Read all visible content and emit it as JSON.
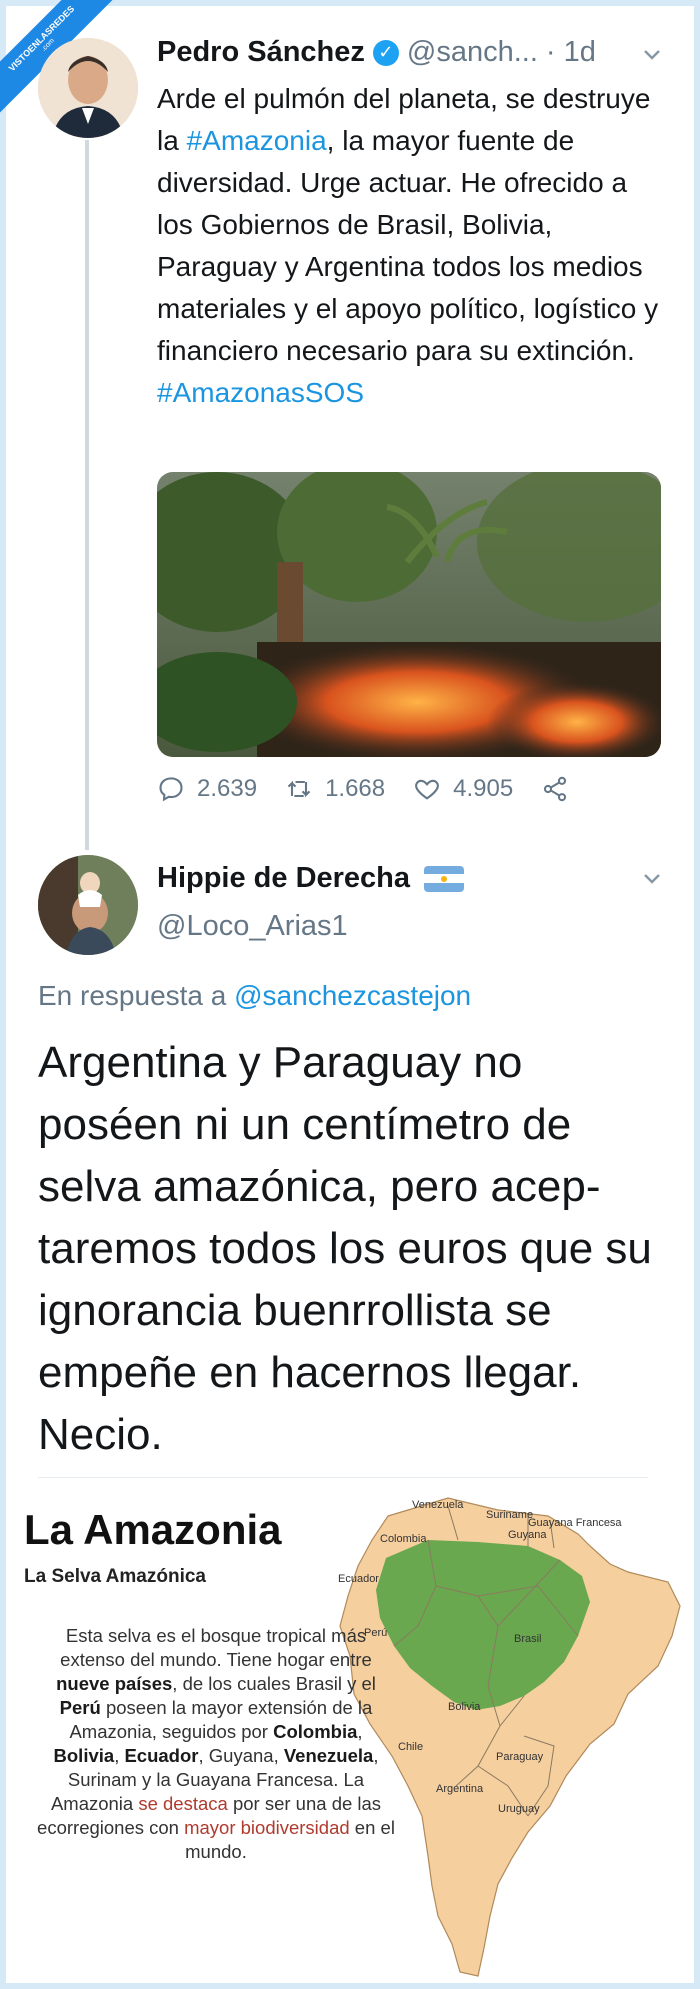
{
  "watermark": {
    "line1": "VISTOENLASREDES",
    "line2": ".com"
  },
  "tweet1": {
    "author": "Pedro Sánchez",
    "handle": "@sanch...",
    "separator": "·",
    "time": "1d",
    "text_before": "Arde el pulmón del planeta, se destruye la ",
    "hashtag1": "#Amazonia",
    "text_after": ", la mayor fuente de diversidad. Urge actuar. He ofrecido a los Gobiernos de Brasil, Bolivia, Paraguay y Argentina todos los medios materiales y el apoyo político, logístico y financiero necesario para su extinción.",
    "hashtag2": "#AmazonasSOS",
    "replies": "2.639",
    "retweets": "1.668",
    "likes": "4.905"
  },
  "tweet2": {
    "author": "Hippie de Derecha",
    "handle": "@Loco_Arias1",
    "reply_label": "En respuesta a ",
    "reply_to": "@sanchezcastejon",
    "text": "Argentina y Paraguay no poséen ni un centímetro de selva amazónica, pero acep-taremos todos los euros que su ignorancia buenrrollista se empeñe en hacernos llegar. Necio."
  },
  "infographic": {
    "title": "La Amazonia",
    "subtitle": "La Selva Amazónica",
    "p1": "Esta selva es el bosque tropical más extenso del mundo. Tiene hogar entre ",
    "b1": "nueve países",
    "p2": ", de los cuales Brasil y el ",
    "b2": "Perú",
    "p3": " poseen la mayor extensión de la Amazonia, seguidos por ",
    "b3": "Colombia",
    "p4": ", ",
    "b4": "Bolivia",
    "p5": ", ",
    "b5": "Ecuador",
    "p6": ", Guyana, ",
    "b6": "Venezuela",
    "p7": ", Surinam y la Guayana Francesa. La Amazonia ",
    "r1": "se destaca",
    "p8": " por ser una de las ecorregiones con ",
    "r2": "mayor biodiversidad",
    "p9": " en el mundo.",
    "map_labels": {
      "venezuela": "Venezuela",
      "suriname": "Suriname",
      "guayana_fr": "Guayana Francesa",
      "guyana": "Guyana",
      "colombia": "Colombia",
      "ecuador": "Ecuador",
      "peru": "Perú",
      "brasil": "Brasil",
      "bolivia": "Bolivia",
      "chile": "Chile",
      "paraguay": "Paraguay",
      "argentina": "Argentina",
      "uruguay": "Uruguay"
    }
  },
  "colors": {
    "link": "#1b95e0",
    "verified": "#1da1f2",
    "land": "#f6cf9f",
    "forest": "#6aa84f"
  }
}
